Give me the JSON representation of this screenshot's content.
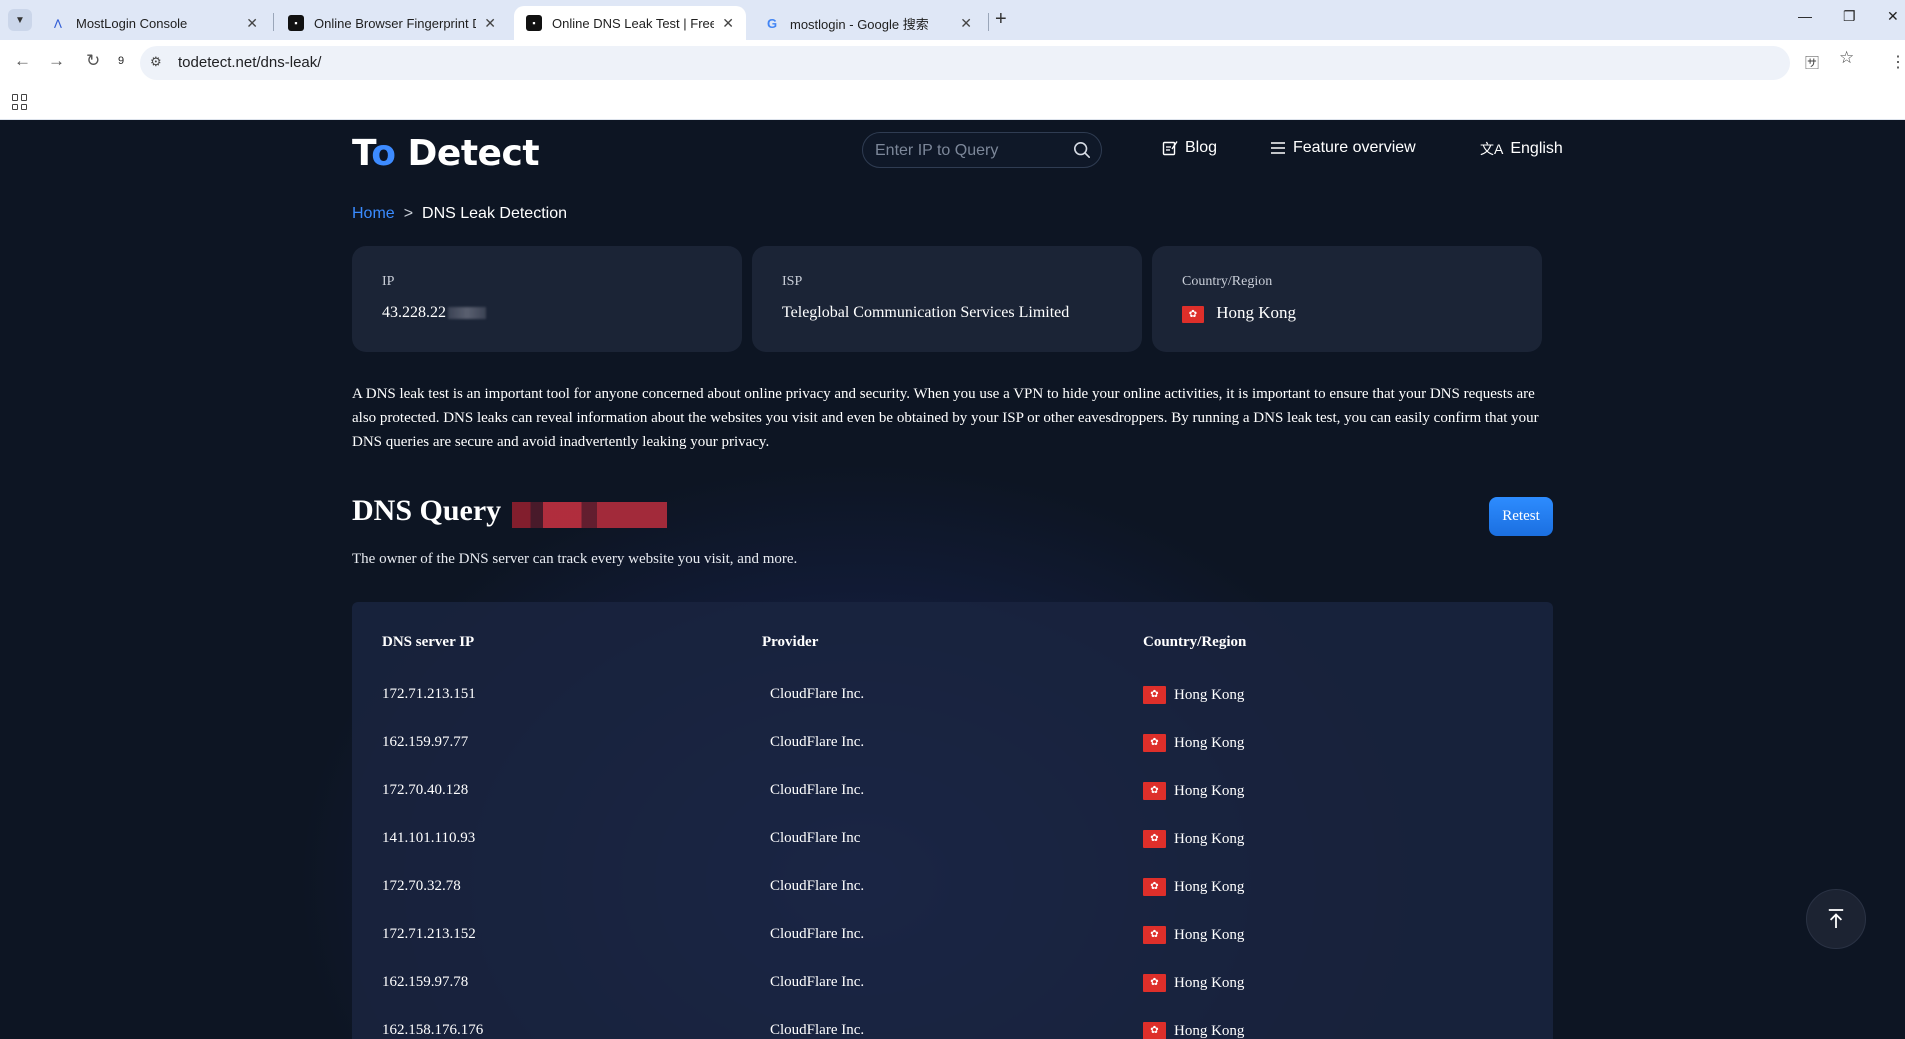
{
  "browser": {
    "tabs": [
      {
        "title": "MostLogin Console"
      },
      {
        "title": "Online Browser Fingerprint De"
      },
      {
        "title": "Online DNS Leak Test | Free V"
      },
      {
        "title": "mostlogin - Google 搜索"
      }
    ],
    "url": "todetect.net/dns-leak/",
    "reload_badge": "9"
  },
  "site": {
    "logo_prefix": "T",
    "logo_o": "o",
    "logo_suffix": " Detect",
    "search_placeholder": "Enter IP to Query",
    "nav": {
      "blog": "Blog",
      "features": "Feature overview",
      "language": "English"
    }
  },
  "breadcrumb": {
    "home": "Home",
    "separator": ">",
    "current": "DNS Leak Detection"
  },
  "info": {
    "ip_label": "IP",
    "ip_value": "43.228.22",
    "isp_label": "ISP",
    "isp_value": "Teleglobal Communication Services Limited",
    "country_label": "Country/Region",
    "country_value": "Hong Kong"
  },
  "description": "A DNS leak test is an important tool for anyone concerned about online privacy and security. When you use a VPN to hide your online activities, it is important to ensure that your DNS requests are also protected. DNS leaks can reveal information about the websites you visit and even be obtained by your ISP or other eavesdroppers. By running a DNS leak test, you can easily confirm that your DNS queries are secure and avoid inadvertently leaking your privacy.",
  "dns_section": {
    "title": "DNS Query",
    "retest_label": "Retest",
    "subtitle": "The owner of the DNS server can track every website you visit, and more.",
    "columns": [
      "DNS server IP",
      "Provider",
      "Country/Region"
    ],
    "rows": [
      {
        "ip": "172.71.213.151",
        "provider": "CloudFlare Inc.",
        "country": "Hong Kong"
      },
      {
        "ip": "162.159.97.77",
        "provider": "CloudFlare Inc.",
        "country": "Hong Kong"
      },
      {
        "ip": "172.70.40.128",
        "provider": "CloudFlare Inc.",
        "country": "Hong Kong"
      },
      {
        "ip": "141.101.110.93",
        "provider": "CloudFlare Inc",
        "country": "Hong Kong"
      },
      {
        "ip": "172.70.32.78",
        "provider": "CloudFlare Inc.",
        "country": "Hong Kong"
      },
      {
        "ip": "172.71.213.152",
        "provider": "CloudFlare Inc.",
        "country": "Hong Kong"
      },
      {
        "ip": "162.159.97.78",
        "provider": "CloudFlare Inc.",
        "country": "Hong Kong"
      },
      {
        "ip": "162.158.176.176",
        "provider": "CloudFlare Inc.",
        "country": "Hong Kong"
      }
    ]
  },
  "colors": {
    "page_bg": "#0d1523",
    "card_bg": "#1b2436",
    "accent_blue": "#3a8bff",
    "flag_red": "#de2f2a"
  },
  "icons": [
    "tab-search-icon",
    "mostlogin-favicon",
    "todetect-favicon",
    "google-favicon",
    "back-icon",
    "forward-icon",
    "reload-icon",
    "site-settings-icon",
    "translate-icon",
    "bookmark-star-icon",
    "apps-icon",
    "search-icon",
    "blog-icon",
    "menu-icon",
    "translate-language-icon",
    "hk-flag-icon",
    "back-to-top-icon"
  ]
}
